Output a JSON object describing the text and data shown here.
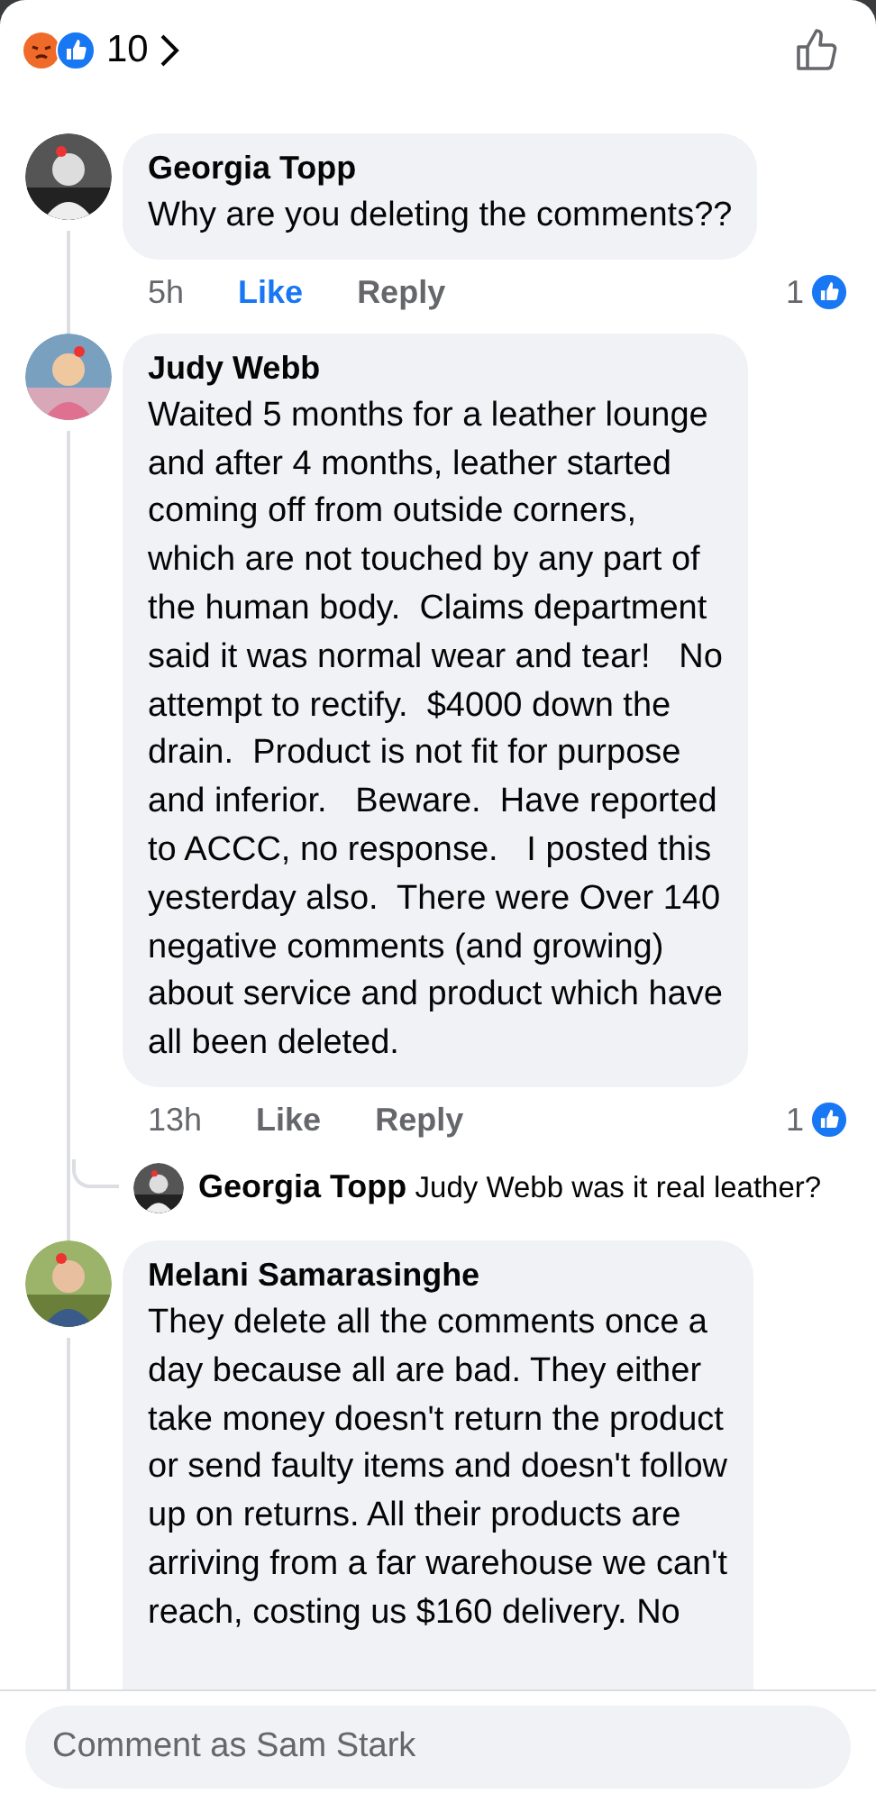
{
  "header": {
    "reaction_count": "10"
  },
  "comments": [
    {
      "author": "Georgia Topp",
      "text": "Why are you deleting the comments??",
      "time": "5h",
      "like": "Like",
      "liked": true,
      "reply": "Reply",
      "reactions": "1"
    },
    {
      "author": "Judy Webb",
      "text": "Waited 5 months for a leather lounge\nand after 4 months, leather started\ncoming off from outside corners,\nwhich are not touched by any part of\nthe human body.  Claims department\nsaid it was normal wear and tear!   No\nattempt to rectify.  $4000 down the\ndrain.  Product is not fit for purpose\nand inferior.   Beware.  Have reported\nto ACCC, no response.   I posted this\nyesterday also.  There were Over 140\nnegative comments (and growing)\nabout service and product which have\nall been deleted.",
      "time": "13h",
      "like": "Like",
      "liked": false,
      "reply": "Reply",
      "reactions": "1",
      "replies": [
        {
          "author": "Georgia Topp",
          "text": "Judy Webb was it real leather?"
        }
      ]
    },
    {
      "author": "Melani Samarasinghe",
      "text": "They delete all the comments once a\nday because all are bad. They either\ntake money doesn't return the product\nor send faulty items and doesn't follow\nup on returns. All their products are\narriving from a far warehouse we can't\nreach, costing us $160 delivery. No"
    }
  ],
  "composer": {
    "placeholder": "Comment as Sam Stark"
  }
}
